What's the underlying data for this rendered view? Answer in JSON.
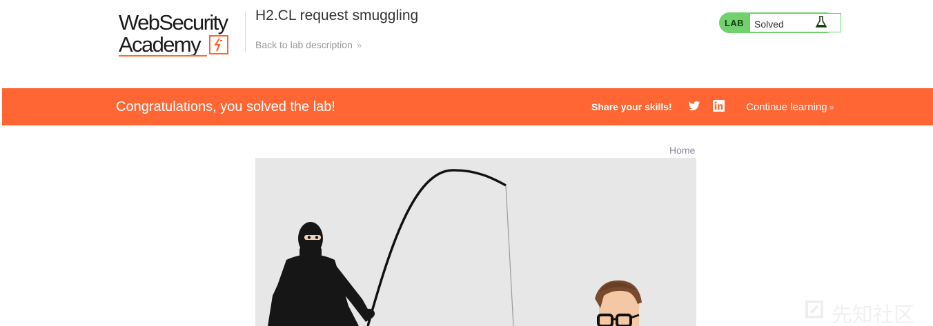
{
  "header": {
    "logo": {
      "line1": "WebSecurity",
      "line2": "Academy"
    },
    "lab_title": "H2.CL request smuggling",
    "back_link": "Back to lab description",
    "back_chevron": "»",
    "status": {
      "tag": "LAB",
      "value": "Solved",
      "icon": "flask-icon"
    }
  },
  "banner": {
    "message": "Congratulations, you solved the lab!",
    "share_label": "Share your skills!",
    "share_icons": [
      "twitter-icon",
      "linkedin-icon"
    ],
    "continue_label": "Continue learning",
    "continue_chevron": "»"
  },
  "content": {
    "home_link": "Home",
    "hero_image": "phishing-illustration"
  },
  "watermark": "先知社区",
  "colors": {
    "accent": "#ff6633",
    "status_green": "#70d16d",
    "hero_bg": "#e7e7e7",
    "text_dark": "#333333",
    "text_muted": "#999999"
  }
}
